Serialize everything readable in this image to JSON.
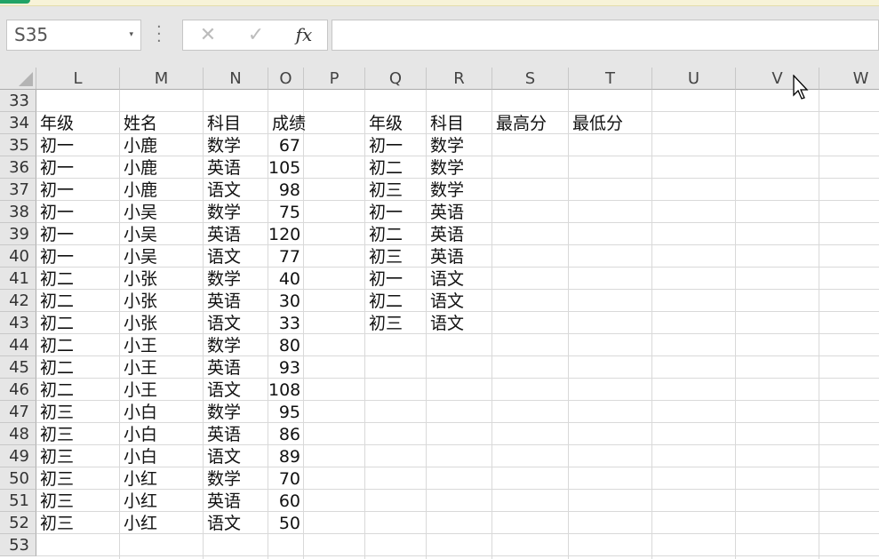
{
  "namebox": {
    "value": "S35"
  },
  "formula_bar": {
    "value": ""
  },
  "columns": [
    "L",
    "M",
    "N",
    "O",
    "P",
    "Q",
    "R",
    "S",
    "T",
    "U",
    "V",
    "W"
  ],
  "rows": [
    "33",
    "34",
    "35",
    "36",
    "37",
    "38",
    "39",
    "40",
    "41",
    "42",
    "43",
    "44",
    "45",
    "46",
    "47",
    "48",
    "49",
    "50",
    "51",
    "52",
    "53"
  ],
  "table1": {
    "headers": [
      "年级",
      "姓名",
      "科目",
      "成绩"
    ],
    "records": [
      [
        "初一",
        "小鹿",
        "数学",
        "67"
      ],
      [
        "初一",
        "小鹿",
        "英语",
        "105"
      ],
      [
        "初一",
        "小鹿",
        "语文",
        "98"
      ],
      [
        "初一",
        "小吴",
        "数学",
        "75"
      ],
      [
        "初一",
        "小吴",
        "英语",
        "120"
      ],
      [
        "初一",
        "小吴",
        "语文",
        "77"
      ],
      [
        "初二",
        "小张",
        "数学",
        "40"
      ],
      [
        "初二",
        "小张",
        "英语",
        "30"
      ],
      [
        "初二",
        "小张",
        "语文",
        "33"
      ],
      [
        "初二",
        "小王",
        "数学",
        "80"
      ],
      [
        "初二",
        "小王",
        "英语",
        "93"
      ],
      [
        "初二",
        "小王",
        "语文",
        "108"
      ],
      [
        "初三",
        "小白",
        "数学",
        "95"
      ],
      [
        "初三",
        "小白",
        "英语",
        "86"
      ],
      [
        "初三",
        "小白",
        "语文",
        "89"
      ],
      [
        "初三",
        "小红",
        "数学",
        "70"
      ],
      [
        "初三",
        "小红",
        "英语",
        "60"
      ],
      [
        "初三",
        "小红",
        "语文",
        "50"
      ]
    ]
  },
  "table2": {
    "headers": [
      "年级",
      "科目",
      "最高分",
      "最低分"
    ],
    "records": [
      [
        "初一",
        "数学"
      ],
      [
        "初二",
        "数学"
      ],
      [
        "初三",
        "数学"
      ],
      [
        "初一",
        "英语"
      ],
      [
        "初二",
        "英语"
      ],
      [
        "初三",
        "英语"
      ],
      [
        "初一",
        "语文"
      ],
      [
        "初二",
        "语文"
      ],
      [
        "初三",
        "语文"
      ]
    ]
  },
  "icons": {
    "cancel": "✕",
    "enter": "✓",
    "insert_function": "fx",
    "dropdown": "▾",
    "cursor": "mouse-pointer-icon"
  },
  "colors": {
    "header_bg": "#e6e6e6",
    "grid": "#d9d9d9",
    "top_accent": "#21a366"
  }
}
